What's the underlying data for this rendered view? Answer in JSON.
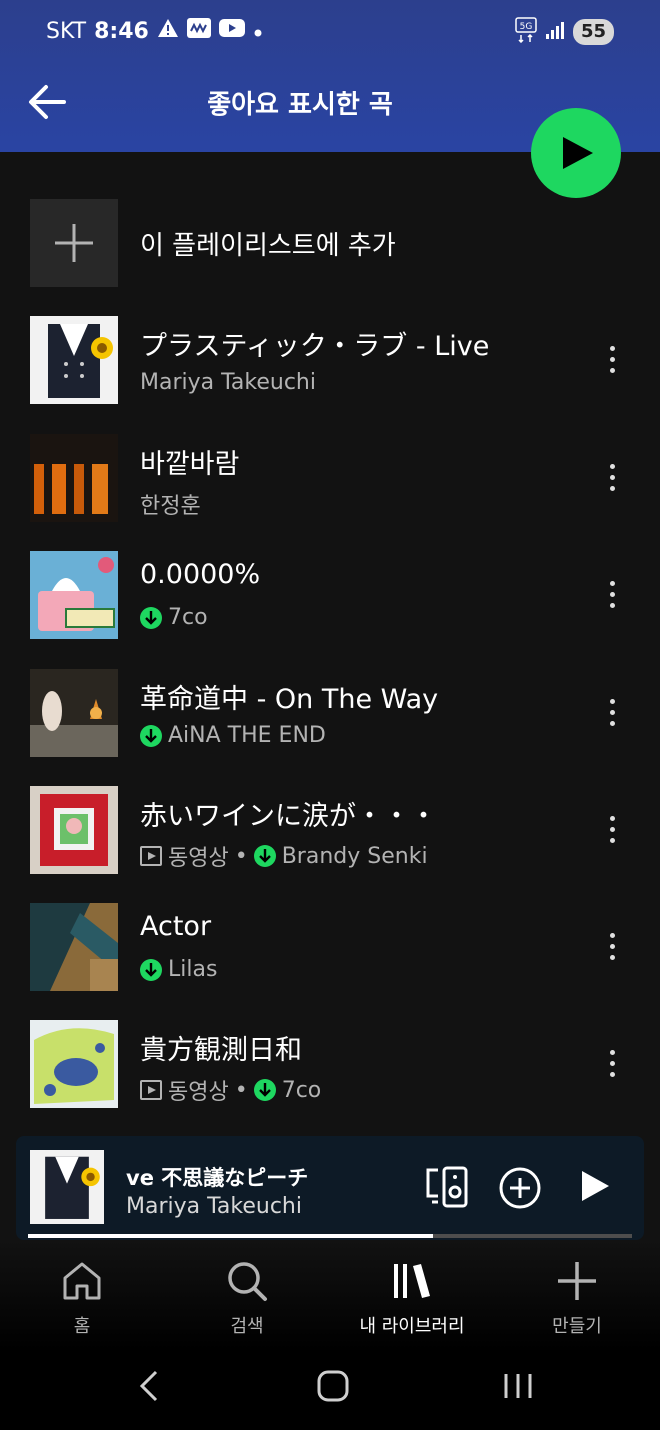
{
  "status": {
    "carrier": "SKT",
    "time": "8:46",
    "network": "5G",
    "battery": "55"
  },
  "header": {
    "title": "좋아요 표시한 곡"
  },
  "add_to_playlist": {
    "label": "이 플레이리스트에 추가"
  },
  "songs": [
    {
      "title": "プラスティック・ラブ - Live",
      "artist": "Mariya Takeuchi",
      "downloaded": false,
      "video_label": ""
    },
    {
      "title": "바깥바람",
      "artist": "한정훈",
      "downloaded": false,
      "video_label": ""
    },
    {
      "title": "0.0000%",
      "artist": "7co",
      "downloaded": true,
      "video_label": ""
    },
    {
      "title": "革命道中 - On The Way",
      "artist": "AiNA THE END",
      "downloaded": true,
      "video_label": ""
    },
    {
      "title": "赤いワインに涙が・・・",
      "artist": "Brandy Senki",
      "downloaded": true,
      "video_label": "동영상"
    },
    {
      "title": "Actor",
      "artist": "Lilas",
      "downloaded": true,
      "video_label": ""
    },
    {
      "title": "貴方観測日和",
      "artist": "7co",
      "downloaded": true,
      "video_label": "동영상"
    }
  ],
  "separator": "•",
  "mini_player": {
    "title": "ve              不思議なピーチ",
    "artist": "Mariya Takeuchi",
    "progress": 0.67
  },
  "bottom_nav": {
    "home": "홈",
    "search": "검색",
    "library": "내 라이브러리",
    "create": "만들기"
  },
  "colors": {
    "accent": "#1ed760",
    "header_gradient_top": "#2c3f8d",
    "background": "#121212"
  }
}
